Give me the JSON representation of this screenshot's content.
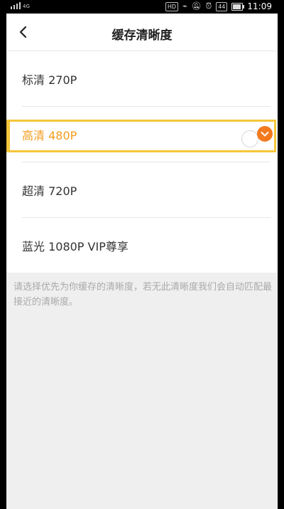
{
  "status_bar": {
    "network": "4G",
    "hd_badge": "HD",
    "battery_level": "44",
    "time": "11:09"
  },
  "header": {
    "title": "缓存清晰度",
    "back_icon": "back-arrow-icon"
  },
  "options": [
    {
      "label": "标清 270P",
      "selected": false
    },
    {
      "label": "高清 480P",
      "selected": true
    },
    {
      "label": "超清 720P",
      "selected": false
    },
    {
      "label": "蓝光 1080P  VIP尊享",
      "selected": false
    }
  ],
  "note": "请选择优先为你缓存的清晰度，若无此清晰度我们会自动匹配最接近的清晰度。",
  "colors": {
    "accent": "#f39c1f",
    "check": "#f37a1f",
    "highlight": "#f6c63b"
  }
}
